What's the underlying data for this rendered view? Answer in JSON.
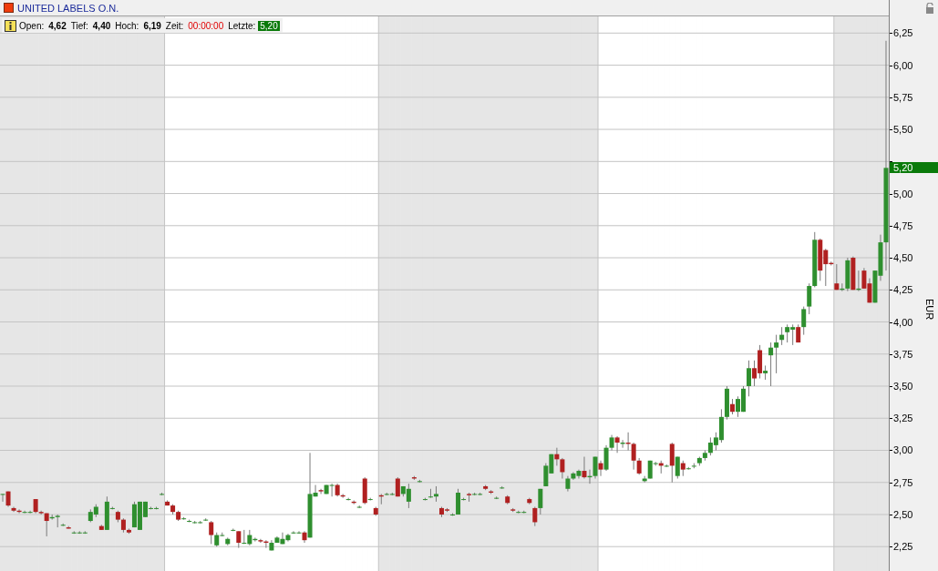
{
  "title": "UNITED LABELS O.N.",
  "quote": [
    {
      "label": "Open:",
      "value": "4,62",
      "kind": "plain"
    },
    {
      "label": "Tief:",
      "value": "4,40",
      "kind": "plain"
    },
    {
      "label": "Hoch:",
      "value": "6,19",
      "kind": "plain"
    },
    {
      "label": "Zeit:",
      "value": "00:00:00",
      "kind": "time"
    },
    {
      "label": "Letzte:",
      "value": "5,20",
      "kind": "last"
    }
  ],
  "axis": {
    "unit": "EUR",
    "last_price": "5,20"
  },
  "slot_shaded": [
    true,
    true,
    true,
    true,
    true,
    true,
    true,
    true,
    true,
    true,
    true,
    true,
    true,
    true,
    true,
    true,
    true,
    true,
    true,
    true,
    true,
    true,
    true,
    true,
    true,
    true,
    true,
    true,
    true,
    true,
    false,
    false,
    false,
    false,
    false,
    false,
    false,
    false,
    false,
    false,
    false,
    false,
    false,
    false,
    false,
    false,
    false,
    false,
    false,
    false,
    false,
    false,
    false,
    false,
    false,
    false,
    false,
    false,
    false,
    false,
    false,
    false,
    false,
    false,
    false,
    false,
    false,
    false,
    false,
    true,
    true,
    true,
    true,
    true,
    true,
    true,
    true,
    true,
    true,
    true,
    true,
    true,
    true,
    true,
    true,
    true,
    true,
    true,
    true,
    true,
    true,
    true,
    true,
    true,
    true,
    true,
    true,
    true,
    true,
    true,
    true,
    true,
    true,
    true,
    true,
    true,
    true,
    true,
    true,
    false,
    false,
    false,
    false,
    false,
    false,
    false,
    false,
    false,
    false,
    false,
    false,
    false,
    false,
    false,
    false,
    false,
    false,
    false,
    false,
    false,
    false,
    false,
    false,
    false,
    false,
    false,
    false,
    false,
    false,
    false,
    false,
    false,
    false,
    false,
    false,
    false,
    false,
    false,
    false,
    false,
    false,
    false,
    true,
    true,
    true,
    true,
    true,
    true,
    true,
    true,
    true,
    true
  ],
  "chart_data": {
    "type": "candlestick",
    "ylim": [
      2.06,
      6.38
    ],
    "yticks": [
      {
        "value": 2.25,
        "label": "2,25"
      },
      {
        "value": 2.5,
        "label": "2,50"
      },
      {
        "value": 2.75,
        "label": "2,75"
      },
      {
        "value": 3,
        "label": "3,00"
      },
      {
        "value": 3.25,
        "label": "3,25"
      },
      {
        "value": 3.5,
        "label": "3,50"
      },
      {
        "value": 3.75,
        "label": "3,75"
      },
      {
        "value": 4,
        "label": "4,00"
      },
      {
        "value": 4.25,
        "label": "4,25"
      },
      {
        "value": 4.5,
        "label": "4,50"
      },
      {
        "value": 4.75,
        "label": "4,75"
      },
      {
        "value": 5,
        "label": "5,00"
      },
      {
        "value": 5.5,
        "label": "5,50"
      },
      {
        "value": 5.75,
        "label": "5,75"
      },
      {
        "value": 6,
        "label": "6,00"
      },
      {
        "value": 6.25,
        "label": "6,25"
      }
    ],
    "categories": [
      null,
      null,
      null,
      null,
      null,
      null,
      null,
      null,
      null,
      null,
      null,
      null,
      null,
      null,
      null,
      null,
      null,
      null,
      null,
      null,
      null,
      null,
      null,
      null,
      null,
      null,
      null,
      null,
      null,
      null,
      null,
      null,
      null,
      null,
      null,
      null,
      null,
      null,
      null,
      null,
      null,
      null,
      null,
      null,
      null,
      null,
      null,
      null,
      null,
      null,
      null,
      null,
      null,
      null,
      null,
      null,
      null,
      null,
      null,
      null,
      null,
      null,
      null,
      null,
      null,
      null,
      null,
      null,
      null,
      null,
      null,
      null,
      null,
      null,
      null,
      null,
      null,
      null,
      null,
      null,
      null,
      null,
      null,
      null,
      null,
      null,
      null,
      null,
      null,
      null,
      null,
      null,
      null,
      null,
      null,
      null,
      null,
      null,
      null,
      null,
      null,
      null,
      null,
      null,
      null,
      null,
      null,
      null,
      null,
      null,
      null,
      null,
      null,
      null,
      null,
      null,
      null,
      null,
      null,
      null,
      null,
      null,
      null,
      null,
      null,
      null,
      null,
      null,
      null,
      null,
      null,
      null,
      null,
      null,
      null,
      null,
      null,
      null,
      null,
      null,
      null,
      null,
      null,
      null,
      null,
      null,
      null,
      null,
      null,
      null,
      null,
      null,
      null,
      null,
      null,
      null,
      null,
      null,
      null,
      null,
      null,
      null
    ],
    "grid": true,
    "ohlc": [
      [
        2.66,
        2.66,
        2.6,
        2.66
      ],
      [
        2.68,
        2.68,
        2.56,
        2.57
      ],
      [
        2.55,
        2.56,
        2.52,
        2.53
      ],
      [
        2.53,
        2.54,
        2.51,
        2.52
      ],
      [
        2.52,
        2.53,
        2.51,
        2.52
      ],
      [
        2.52,
        2.53,
        2.51,
        2.52
      ],
      [
        2.62,
        2.62,
        2.51,
        2.52
      ],
      [
        2.52,
        2.53,
        2.5,
        2.51
      ],
      [
        2.51,
        2.51,
        2.33,
        2.45
      ],
      [
        2.47,
        2.5,
        2.46,
        2.48
      ],
      [
        2.48,
        2.5,
        2.4,
        2.49
      ],
      [
        2.42,
        2.43,
        2.41,
        2.42
      ],
      [
        2.4,
        2.41,
        2.39,
        2.39
      ],
      [
        2.36,
        2.37,
        2.35,
        2.36
      ],
      [
        2.36,
        2.37,
        2.35,
        2.36
      ],
      [
        2.36,
        2.37,
        2.35,
        2.36
      ],
      [
        2.45,
        2.54,
        2.44,
        2.52
      ],
      [
        2.5,
        2.58,
        2.48,
        2.56
      ],
      [
        2.41,
        2.42,
        2.38,
        2.38
      ],
      [
        2.38,
        2.64,
        2.38,
        2.6
      ],
      [
        2.55,
        2.56,
        2.54,
        2.55
      ],
      [
        2.52,
        2.53,
        2.44,
        2.46
      ],
      [
        2.46,
        2.47,
        2.36,
        2.38
      ],
      [
        2.38,
        2.39,
        2.35,
        2.36
      ],
      [
        2.4,
        2.6,
        2.4,
        2.58
      ],
      [
        2.38,
        2.6,
        2.38,
        2.6
      ],
      [
        2.48,
        2.6,
        2.48,
        2.6
      ],
      [
        2.55,
        2.56,
        2.54,
        2.55
      ],
      [
        2.55,
        2.56,
        2.54,
        2.55
      ],
      [
        2.66,
        2.67,
        2.65,
        2.66
      ],
      [
        2.6,
        2.61,
        2.57,
        2.57
      ],
      [
        2.57,
        2.58,
        2.5,
        2.52
      ],
      [
        2.52,
        2.53,
        2.45,
        2.46
      ],
      [
        2.47,
        2.48,
        2.46,
        2.47
      ],
      [
        2.45,
        2.46,
        2.44,
        2.45
      ],
      [
        2.44,
        2.45,
        2.43,
        2.44
      ],
      [
        2.44,
        2.45,
        2.43,
        2.44
      ],
      [
        2.46,
        2.47,
        2.45,
        2.46
      ],
      [
        2.44,
        2.45,
        2.27,
        2.34
      ],
      [
        2.26,
        2.36,
        2.25,
        2.34
      ],
      [
        2.34,
        2.36,
        2.33,
        2.34
      ],
      [
        2.27,
        2.32,
        2.26,
        2.31
      ],
      [
        2.38,
        2.39,
        2.37,
        2.38
      ],
      [
        2.37,
        2.37,
        2.24,
        2.28
      ],
      [
        2.28,
        2.38,
        2.27,
        2.28
      ],
      [
        2.27,
        2.38,
        2.26,
        2.34
      ],
      [
        2.3,
        2.32,
        2.29,
        2.31
      ],
      [
        2.3,
        2.31,
        2.28,
        2.29
      ],
      [
        2.29,
        2.3,
        2.24,
        2.28
      ],
      [
        2.22,
        2.3,
        2.22,
        2.28
      ],
      [
        2.28,
        2.33,
        2.28,
        2.32
      ],
      [
        2.27,
        2.36,
        2.27,
        2.31
      ],
      [
        2.3,
        2.35,
        2.29,
        2.34
      ],
      [
        2.36,
        2.37,
        2.35,
        2.36
      ],
      [
        2.36,
        2.37,
        2.35,
        2.36
      ],
      [
        2.36,
        2.37,
        2.28,
        2.3
      ],
      [
        2.32,
        2.98,
        2.32,
        2.66
      ],
      [
        2.64,
        2.73,
        2.64,
        2.67
      ],
      [
        2.69,
        2.7,
        2.66,
        2.68
      ],
      [
        2.66,
        2.73,
        2.66,
        2.73
      ],
      [
        2.73,
        2.74,
        2.64,
        2.73
      ],
      [
        2.73,
        2.74,
        2.64,
        2.65
      ],
      [
        2.65,
        2.66,
        2.63,
        2.64
      ],
      [
        2.62,
        2.63,
        2.61,
        2.62
      ],
      [
        2.6,
        2.61,
        2.58,
        2.59
      ],
      [
        2.56,
        2.57,
        2.55,
        2.56
      ],
      [
        2.78,
        2.79,
        2.58,
        2.59
      ],
      [
        2.62,
        2.63,
        2.61,
        2.62
      ],
      [
        2.55,
        2.56,
        2.49,
        2.5
      ],
      [
        2.65,
        2.66,
        2.58,
        2.64
      ],
      [
        2.66,
        2.67,
        2.65,
        2.66
      ],
      [
        2.66,
        2.67,
        2.65,
        2.66
      ],
      [
        2.78,
        2.79,
        2.64,
        2.64
      ],
      [
        2.66,
        2.72,
        2.64,
        2.72
      ],
      [
        2.6,
        2.74,
        2.55,
        2.7
      ],
      [
        2.79,
        2.8,
        2.77,
        2.78
      ],
      [
        2.76,
        2.77,
        2.75,
        2.76
      ],
      [
        2.62,
        2.63,
        2.61,
        2.62
      ],
      [
        2.64,
        2.7,
        2.63,
        2.64
      ],
      [
        2.64,
        2.72,
        2.6,
        2.66
      ],
      [
        2.55,
        2.56,
        2.48,
        2.5
      ],
      [
        2.54,
        2.55,
        2.52,
        2.53
      ],
      [
        2.5,
        2.51,
        2.49,
        2.5
      ],
      [
        2.5,
        2.7,
        2.5,
        2.67
      ],
      [
        2.62,
        2.63,
        2.61,
        2.62
      ],
      [
        2.66,
        2.67,
        2.6,
        2.65
      ],
      [
        2.66,
        2.67,
        2.65,
        2.66
      ],
      [
        2.66,
        2.67,
        2.65,
        2.66
      ],
      [
        2.72,
        2.73,
        2.69,
        2.7
      ],
      [
        2.68,
        2.69,
        2.66,
        2.67
      ],
      [
        2.63,
        2.64,
        2.62,
        2.63
      ],
      [
        2.71,
        2.72,
        2.7,
        2.71
      ],
      [
        2.64,
        2.65,
        2.58,
        2.59
      ],
      [
        2.54,
        2.55,
        2.52,
        2.53
      ],
      [
        2.52,
        2.53,
        2.51,
        2.52
      ],
      [
        2.52,
        2.53,
        2.51,
        2.52
      ],
      [
        2.62,
        2.63,
        2.58,
        2.59
      ],
      [
        2.55,
        2.56,
        2.41,
        2.44
      ],
      [
        2.55,
        2.7,
        2.5,
        2.7
      ],
      [
        2.72,
        2.9,
        2.72,
        2.88
      ],
      [
        2.82,
        2.97,
        2.82,
        2.97
      ],
      [
        2.97,
        3.02,
        2.88,
        2.93
      ],
      [
        2.93,
        2.94,
        2.78,
        2.83
      ],
      [
        2.7,
        2.8,
        2.68,
        2.78
      ],
      [
        2.78,
        2.83,
        2.77,
        2.82
      ],
      [
        2.8,
        2.85,
        2.78,
        2.84
      ],
      [
        2.84,
        2.95,
        2.78,
        2.79
      ],
      [
        2.79,
        2.85,
        2.74,
        2.8
      ],
      [
        2.8,
        2.95,
        2.78,
        2.95
      ],
      [
        2.9,
        2.92,
        2.8,
        2.85
      ],
      [
        2.85,
        3.04,
        2.84,
        3.02
      ],
      [
        3.02,
        3.12,
        3.0,
        3.1
      ],
      [
        3.1,
        3.11,
        2.98,
        3.06
      ],
      [
        3.05,
        3.08,
        3.02,
        3.06
      ],
      [
        3.06,
        3.14,
        3.0,
        3.05
      ],
      [
        3.05,
        3.06,
        2.85,
        2.92
      ],
      [
        2.92,
        2.94,
        2.81,
        2.82
      ],
      [
        2.76,
        2.8,
        2.75,
        2.78
      ],
      [
        2.78,
        2.92,
        2.78,
        2.92
      ],
      [
        2.9,
        2.91,
        2.88,
        2.9
      ],
      [
        2.9,
        2.92,
        2.82,
        2.88
      ],
      [
        2.88,
        2.89,
        2.87,
        2.88
      ],
      [
        3.05,
        3.06,
        2.75,
        2.88
      ],
      [
        2.8,
        2.95,
        2.78,
        2.95
      ],
      [
        2.9,
        2.92,
        2.8,
        2.85
      ],
      [
        2.86,
        2.87,
        2.85,
        2.86
      ],
      [
        2.88,
        2.9,
        2.86,
        2.88
      ],
      [
        2.9,
        2.95,
        2.88,
        2.94
      ],
      [
        2.94,
        3.0,
        2.92,
        2.98
      ],
      [
        2.98,
        3.1,
        2.96,
        3.06
      ],
      [
        3.04,
        3.14,
        3.0,
        3.1
      ],
      [
        3.08,
        3.32,
        3.06,
        3.26
      ],
      [
        3.26,
        3.5,
        3.24,
        3.48
      ],
      [
        3.36,
        3.4,
        3.28,
        3.3
      ],
      [
        3.3,
        3.42,
        3.26,
        3.4
      ],
      [
        3.3,
        3.5,
        3.3,
        3.48
      ],
      [
        3.5,
        3.7,
        3.42,
        3.64
      ],
      [
        3.64,
        3.7,
        3.5,
        3.56
      ],
      [
        3.78,
        3.82,
        3.56,
        3.6
      ],
      [
        3.6,
        3.66,
        3.55,
        3.62
      ],
      [
        3.74,
        3.84,
        3.5,
        3.8
      ],
      [
        3.8,
        3.9,
        3.6,
        3.84
      ],
      [
        3.86,
        3.96,
        3.82,
        3.9
      ],
      [
        3.92,
        3.98,
        3.84,
        3.96
      ],
      [
        3.94,
        3.98,
        3.82,
        3.96
      ],
      [
        3.96,
        3.98,
        3.84,
        3.84
      ],
      [
        3.96,
        4.12,
        3.9,
        4.1
      ],
      [
        4.12,
        4.3,
        4.06,
        4.28
      ],
      [
        4.28,
        4.7,
        4.27,
        4.64
      ],
      [
        4.64,
        4.65,
        4.32,
        4.4
      ],
      [
        4.56,
        4.57,
        4.28,
        4.45
      ],
      [
        4.46,
        4.47,
        4.44,
        4.45
      ],
      [
        4.3,
        4.45,
        4.25,
        4.25
      ],
      [
        4.25,
        4.3,
        4.24,
        4.26
      ],
      [
        4.26,
        4.5,
        4.24,
        4.48
      ],
      [
        4.5,
        4.51,
        4.25,
        4.25
      ],
      [
        4.25,
        4.4,
        4.24,
        4.26
      ],
      [
        4.4,
        4.42,
        4.26,
        4.26
      ],
      [
        4.3,
        4.34,
        4.15,
        4.15
      ],
      [
        4.15,
        4.4,
        4.15,
        4.4
      ],
      [
        4.36,
        4.68,
        4.32,
        4.62
      ],
      [
        4.62,
        6.19,
        4.4,
        5.2
      ]
    ]
  }
}
